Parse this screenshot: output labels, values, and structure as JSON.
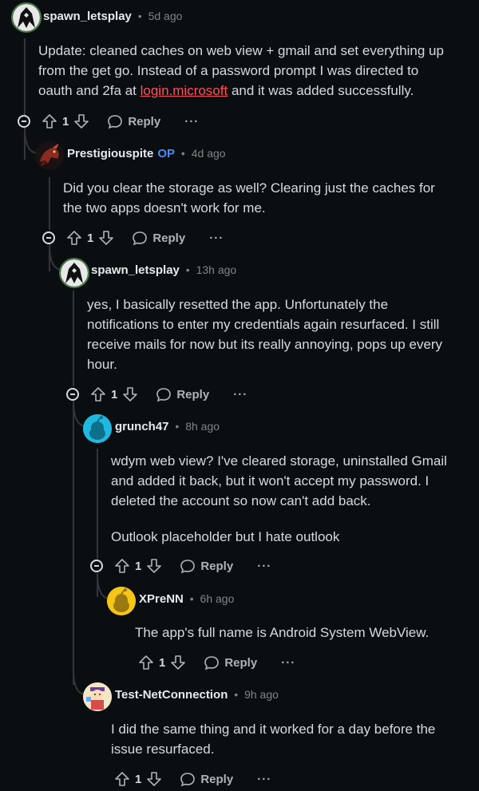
{
  "comments": [
    {
      "username": "spawn_letsplay",
      "time": "5d ago",
      "lines": [
        "Update: cleaned caches on web view + gmail and set everything up",
        "from the get go. Instead of a password prompt I was directed to"
      ],
      "line3_pre": "oauth and 2fa at ",
      "line3_link": "login.microsoft",
      "line3_post": " and it was added successfully.",
      "votes": "1",
      "reply_label": "Reply",
      "more_label": "···"
    },
    {
      "username": "Prestigiouspite",
      "op_badge": "OP",
      "time": "4d ago",
      "lines": [
        "Did you clear the storage as well? Clearing just the caches for",
        "the two apps doesn't work for me."
      ],
      "votes": "1",
      "reply_label": "Reply",
      "more_label": "···"
    },
    {
      "username": "spawn_letsplay",
      "time": "13h ago",
      "lines": [
        "yes, I basically resetted the app. Unfortunately the",
        "notifications to enter my credentials again resurfaced. I still",
        "receive mails for now but its really annoying, pops up every",
        "hour."
      ],
      "votes": "1",
      "reply_label": "Reply",
      "more_label": "···"
    },
    {
      "username": "grunch47",
      "time": "8h ago",
      "lines": [
        "wdym web view? I've cleared storage, uninstalled Gmail",
        "and added it back, but it won't accept my password. I",
        "deleted the account so now can't add back."
      ],
      "extra_line": "Outlook placeholder but I hate outlook",
      "votes": "1",
      "reply_label": "Reply",
      "more_label": "···"
    },
    {
      "username": "XPreNN",
      "time": "6h ago",
      "lines": [
        "The app's full name is Android System WebView."
      ],
      "votes": "1",
      "reply_label": "Reply",
      "more_label": "···"
    },
    {
      "username": "Test-NetConnection",
      "time": "9h ago",
      "lines": [
        "I did the same thing and it worked for a day before the",
        "issue resurfaced."
      ],
      "votes": "1",
      "reply_label": "Reply",
      "more_label": "···"
    }
  ],
  "colors": {
    "background": "#0b0e10",
    "thread_line": "#343536",
    "op_badge": "#4a8cf0",
    "link": "#ff4f57",
    "snoo_blue": "#1fb8e0",
    "snoo_yellow": "#f5c518"
  },
  "icons": [
    "collapse-icon",
    "upvote-icon",
    "downvote-icon",
    "reply-bubble-icon",
    "more-options-icon"
  ]
}
